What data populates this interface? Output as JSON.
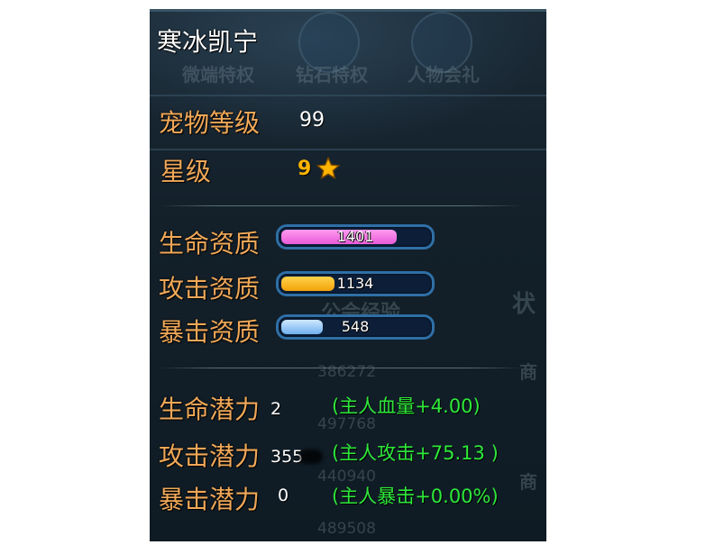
{
  "pet": {
    "name": "寒冰凯宁"
  },
  "level": {
    "label": "宠物等级",
    "value": "99"
  },
  "star": {
    "label": "星级",
    "value": "9"
  },
  "aptitude": [
    {
      "label": "生命资质",
      "value": "1401",
      "fill_fraction": 0.78,
      "color": "#e85ad8"
    },
    {
      "label": "攻击资质",
      "value": "1134",
      "fill_fraction": 0.36,
      "color": "#f2a20a"
    },
    {
      "label": "暴击资质",
      "value": "548",
      "fill_fraction": 0.28,
      "color": "#6fb0ee"
    }
  ],
  "potential": [
    {
      "label": "生命潜力",
      "value": "2",
      "bonus": "(主人血量+4.00)"
    },
    {
      "label": "攻击潜力",
      "value": "355",
      "bonus": "(主人攻击+75.13 )"
    },
    {
      "label": "暴击潜力",
      "value": "0",
      "bonus": "(主人暴击+0.00%)"
    }
  ],
  "background": {
    "banner_items": [
      "微端特权",
      "钻石特权",
      "人物会礼"
    ],
    "side_words": [
      "状",
      "商",
      "商",
      "商"
    ],
    "side_heading": "公会经验",
    "faint_numbers": [
      "386272",
      "497768",
      "440940",
      "489508"
    ]
  }
}
